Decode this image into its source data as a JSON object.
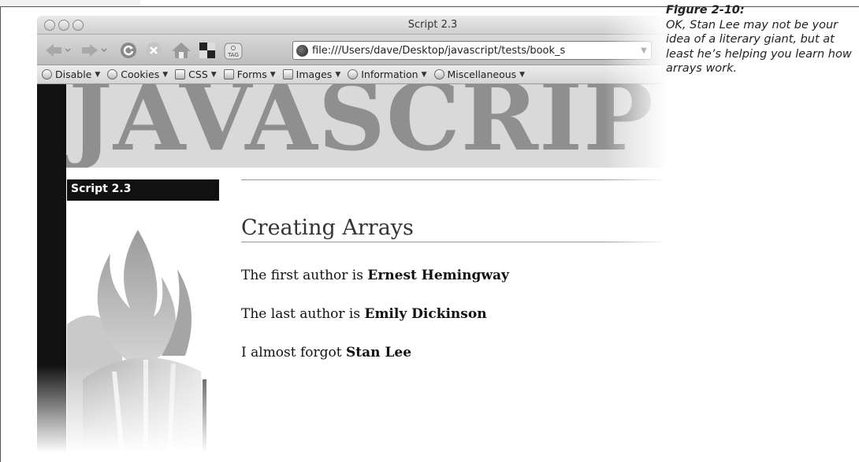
{
  "caption": {
    "figure_label": "Figure 2-10:",
    "text": "OK, Stan Lee may not be your idea of a literary giant, but at least he’s helping you learn how arrays work."
  },
  "window": {
    "title": "Script 2.3"
  },
  "toolbar": {
    "tag_label": "TAG",
    "url": "file:///Users/dave/Desktop/javascript/tests/book_s"
  },
  "devbar": {
    "items": [
      "Disable",
      "Cookies",
      "CSS",
      "Forms",
      "Images",
      "Information",
      "Miscellaneous"
    ]
  },
  "page": {
    "banner_text": "JAVASCRIP",
    "side_label": "Script 2.3",
    "heading": "Creating Arrays",
    "lines": [
      {
        "prefix": "The first author is ",
        "name": "Ernest Hemingway"
      },
      {
        "prefix": "The last author is ",
        "name": "Emily Dickinson"
      },
      {
        "prefix": "I almost forgot ",
        "name": "Stan Lee"
      }
    ]
  },
  "icons": [
    "back-icon",
    "forward-icon",
    "reload-icon",
    "stop-icon",
    "home-icon",
    "grid-icon",
    "tag-icon",
    "globe-icon",
    "url-dropdown-icon",
    "go-icon"
  ]
}
